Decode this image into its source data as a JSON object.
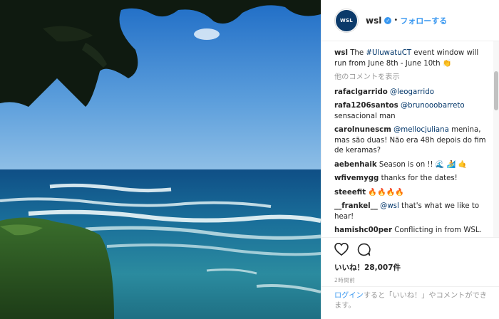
{
  "header": {
    "avatar_text": "WSL",
    "username": "wsl",
    "verified_mark": "✓",
    "separator": "•",
    "follow_label": "フォローする"
  },
  "caption": {
    "user": "wsl",
    "text_before": " The ",
    "hashtag": "#UluwatuCT",
    "text_after": " event window will run from June 8th - June 10th 👏"
  },
  "load_more": "他のコメントを表示",
  "comments": [
    {
      "user": "rafaclgarrido",
      "mention": "@leogarrido",
      "text": ""
    },
    {
      "user": "rafa1206santos",
      "mention": "@brunooobarreto",
      "text": " sensacional man"
    },
    {
      "user": "carolnunescm",
      "mention": "@mellocjuliana",
      "text": " menina, mas são duas! Não era 48h depois do fim de keramas?"
    },
    {
      "user": "aebenhaik",
      "mention": "",
      "text": " Season is on !! 🌊 🏄 🤙"
    },
    {
      "user": "wfivemygg",
      "mention": "",
      "text": " thanks for the dates!"
    },
    {
      "user": "steeefit",
      "mention": "",
      "text": " 🔥🔥🔥🔥"
    },
    {
      "user": "__frankel__",
      "mention": "@wsl",
      "text": " that's what we like to hear!"
    },
    {
      "user": "hamishc00per",
      "mention": "",
      "text": " Conflicting in from WSL. As well as misleading info on the event page as well. I feel they should call it Margaret"
    }
  ],
  "actions": {
    "like_icon": "heart-icon",
    "comment_icon": "comment-icon",
    "likes_text": "いいね！28,007件",
    "time_text": "2時間前"
  },
  "login_prompt": {
    "link": "ログイン",
    "text": "すると「いいね！」やコメントができます。"
  },
  "colors": {
    "accent": "#3897f0",
    "link": "#003569",
    "ocean": "#1e6f96",
    "sky": "#2f7fd0"
  }
}
